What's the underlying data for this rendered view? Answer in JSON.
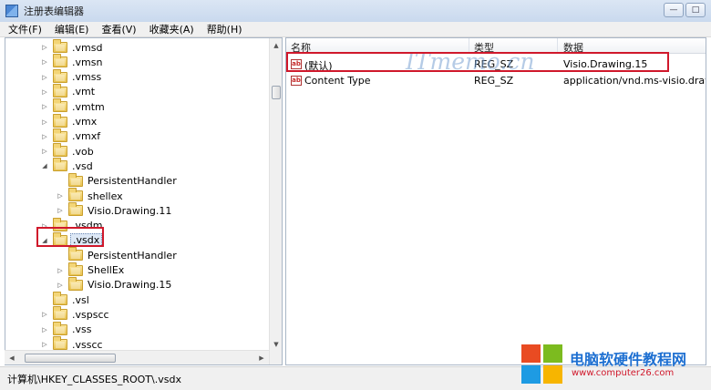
{
  "window": {
    "title": "注册表编辑器",
    "controls": {
      "minimize": "—",
      "maximize": "□",
      "close": "✕"
    }
  },
  "menu": [
    "文件(F)",
    "编辑(E)",
    "查看(V)",
    "收藏夹(A)",
    "帮助(H)"
  ],
  "tree": {
    "nodes": [
      {
        "label": ".vmsd",
        "level": 0,
        "expander": "▷"
      },
      {
        "label": ".vmsn",
        "level": 0,
        "expander": "▷"
      },
      {
        "label": ".vmss",
        "level": 0,
        "expander": "▷"
      },
      {
        "label": ".vmt",
        "level": 0,
        "expander": "▷"
      },
      {
        "label": ".vmtm",
        "level": 0,
        "expander": "▷"
      },
      {
        "label": ".vmx",
        "level": 0,
        "expander": "▷"
      },
      {
        "label": ".vmxf",
        "level": 0,
        "expander": "▷"
      },
      {
        "label": ".vob",
        "level": 0,
        "expander": "▷"
      },
      {
        "label": ".vsd",
        "level": 0,
        "expander": "◢"
      },
      {
        "label": "PersistentHandler",
        "level": 1,
        "expander": ""
      },
      {
        "label": "shellex",
        "level": 1,
        "expander": "▷"
      },
      {
        "label": "Visio.Drawing.11",
        "level": 1,
        "expander": "▷"
      },
      {
        "label": ".vsdm",
        "level": 0,
        "expander": "▷"
      },
      {
        "label": ".vsdx",
        "level": 0,
        "expander": "◢",
        "selected": true
      },
      {
        "label": "PersistentHandler",
        "level": 1,
        "expander": ""
      },
      {
        "label": "ShellEx",
        "level": 1,
        "expander": "▷"
      },
      {
        "label": "Visio.Drawing.15",
        "level": 1,
        "expander": "▷"
      },
      {
        "label": ".vsl",
        "level": 0,
        "expander": ""
      },
      {
        "label": ".vspscc",
        "level": 0,
        "expander": "▷"
      },
      {
        "label": ".vss",
        "level": 0,
        "expander": "▷"
      },
      {
        "label": ".vsscc",
        "level": 0,
        "expander": "▷"
      }
    ]
  },
  "values": {
    "columns": {
      "name": "名称",
      "type": "类型",
      "data": "数据"
    },
    "rows": [
      {
        "icon": "ab",
        "name": "(默认)",
        "type": "REG_SZ",
        "data": "Visio.Drawing.15"
      },
      {
        "icon": "ab",
        "name": "Content Type",
        "type": "REG_SZ",
        "data": "application/vnd.ms-visio.drawing"
      }
    ]
  },
  "watermark": "ITmemo.cn",
  "status": {
    "path": "计算机\\HKEY_CLASSES_ROOT\\.vsdx"
  },
  "brand": {
    "name": "电脑软硬件教程网",
    "url": "www.computer26.com",
    "colors": [
      "#e94b22",
      "#7cbb1f",
      "#1e9be3",
      "#f7b500"
    ]
  },
  "accent": {
    "highlight": "#d0182b"
  }
}
